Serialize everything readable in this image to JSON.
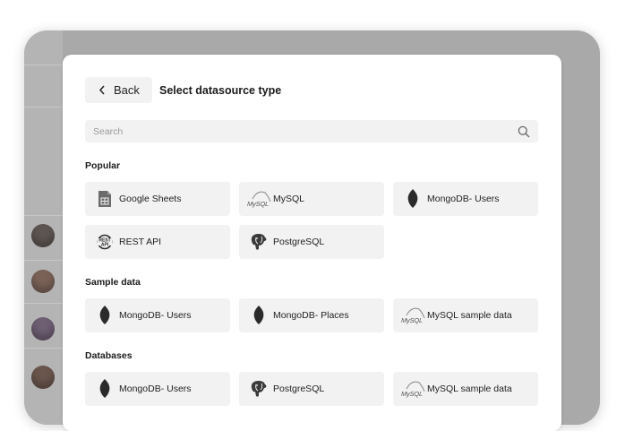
{
  "dialog": {
    "back_label": "Back",
    "title": "Select datasource type",
    "search_placeholder": "Search"
  },
  "sections": [
    {
      "title": "Popular"
    },
    {
      "title": "Sample data"
    },
    {
      "title": "Databases"
    }
  ],
  "popular": [
    {
      "label": "Google Sheets",
      "icon": "google-sheets-icon"
    },
    {
      "label": "MySQL",
      "icon": "mysql-icon"
    },
    {
      "label": "MongoDB- Users",
      "icon": "mongodb-icon"
    },
    {
      "label": "REST API",
      "icon": "rest-api-icon"
    },
    {
      "label": "PostgreSQL",
      "icon": "postgresql-icon"
    }
  ],
  "sample_data": [
    {
      "label": "MongoDB- Users",
      "icon": "mongodb-icon"
    },
    {
      "label": "MongoDB- Places",
      "icon": "mongodb-icon"
    },
    {
      "label": "MySQL sample data",
      "icon": "mysql-icon"
    }
  ],
  "databases": [
    {
      "label": "MongoDB- Users",
      "icon": "mongodb-icon"
    },
    {
      "label": "PostgreSQL",
      "icon": "postgresql-icon"
    },
    {
      "label": "MySQL sample data",
      "icon": "mysql-icon"
    }
  ],
  "logo_text": {
    "mysql": "MySQL",
    "rest": "REST API"
  }
}
